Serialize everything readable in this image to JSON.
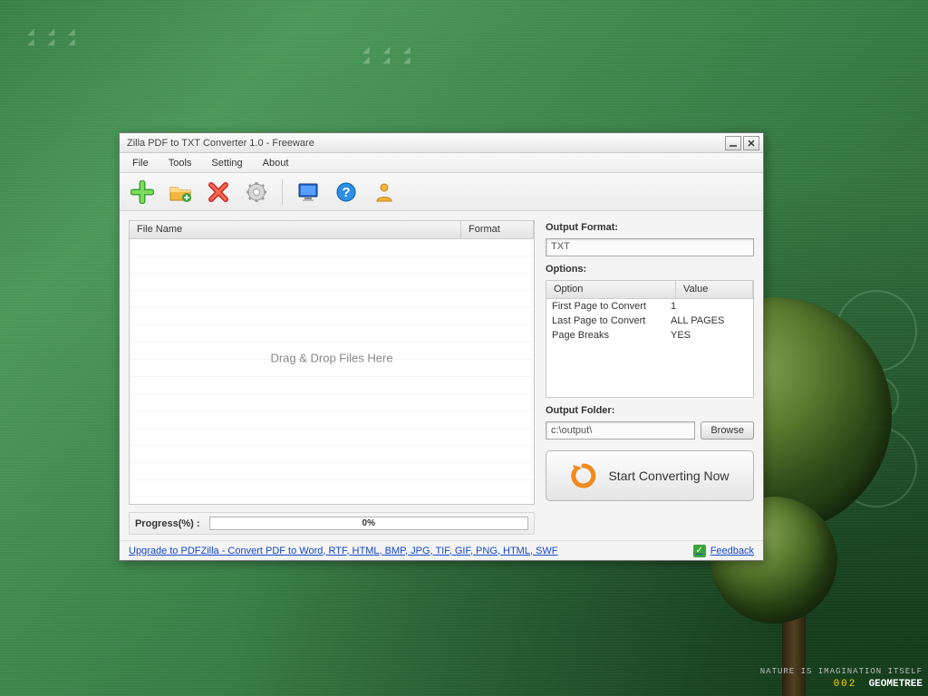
{
  "desktop": {
    "wallpaper_caption_line1": "NATURE IS  IMAGINATION ITSELF",
    "wallpaper_code": "002",
    "wallpaper_name": "GEOMETREE"
  },
  "window": {
    "title": "Zilla PDF to TXT Converter 1.0 - Freeware"
  },
  "menubar": {
    "file": "File",
    "tools": "Tools",
    "setting": "Setting",
    "about": "About"
  },
  "toolbar": {
    "add": "add-file",
    "add_folder": "add-folder",
    "remove": "remove",
    "settings": "settings",
    "monitor": "display",
    "help": "help",
    "user": "user"
  },
  "filelist": {
    "col_filename": "File Name",
    "col_format": "Format",
    "drop_hint": "Drag & Drop Files Here"
  },
  "progress": {
    "label": "Progress(%)  :",
    "value_text": "0%"
  },
  "output": {
    "format_label": "Output Format:",
    "format_value": "TXT",
    "options_label": "Options:",
    "options_col_option": "Option",
    "options_col_value": "Value",
    "options_rows": [
      {
        "option": "First Page to Convert",
        "value": "1"
      },
      {
        "option": "Last Page to Convert",
        "value": "ALL PAGES"
      },
      {
        "option": "Page Breaks",
        "value": "YES"
      }
    ],
    "folder_label": "Output Folder:",
    "folder_value": "c:\\output\\",
    "browse_label": "Browse",
    "convert_label": "Start Converting Now"
  },
  "footer": {
    "upgrade_link": "Upgrade to PDFZilla - Convert PDF to Word, RTF, HTML, BMP, JPG, TIF, GIF, PNG, HTML, SWF",
    "feedback_label": "Feedback"
  }
}
